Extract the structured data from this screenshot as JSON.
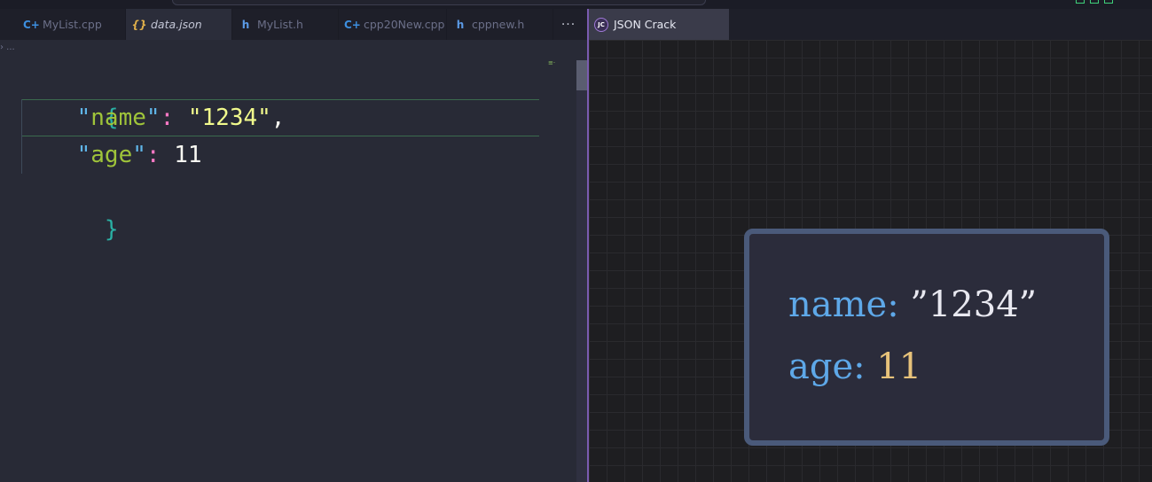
{
  "left_tabs": [
    {
      "icon": "cpp-file-icon",
      "label": "MyList.cpp"
    },
    {
      "icon": "json-file-icon",
      "label": "data.json"
    },
    {
      "icon": "header-file-icon",
      "label": "MyList.h"
    },
    {
      "icon": "cpp-file-icon",
      "label": "cpp20New.cpp"
    },
    {
      "icon": "header-file-icon",
      "label": "cppnew.h"
    }
  ],
  "more_label": "···",
  "breadcrumb": "› ...",
  "editor": {
    "open_brace": "{",
    "close_brace": "}",
    "line1": {
      "q1": "\"",
      "key": "name",
      "q2": "\"",
      "colon": ":",
      "value": "\"1234\"",
      "comma": ","
    },
    "line2": {
      "q1": "\"",
      "key": "age",
      "q2": "\"",
      "colon": ":",
      "value": "11"
    }
  },
  "right_tab": {
    "logo": "JC",
    "label": "JSON Crack"
  },
  "node": {
    "row1": {
      "key": "name:",
      "value": "”1234”"
    },
    "row2": {
      "key": "age:",
      "value": "11"
    }
  },
  "colors": {
    "accent": "#7a5bb0",
    "json_key": "#9fc43a",
    "string": "#f1fa8c",
    "node_border": "#4a5a7a"
  }
}
